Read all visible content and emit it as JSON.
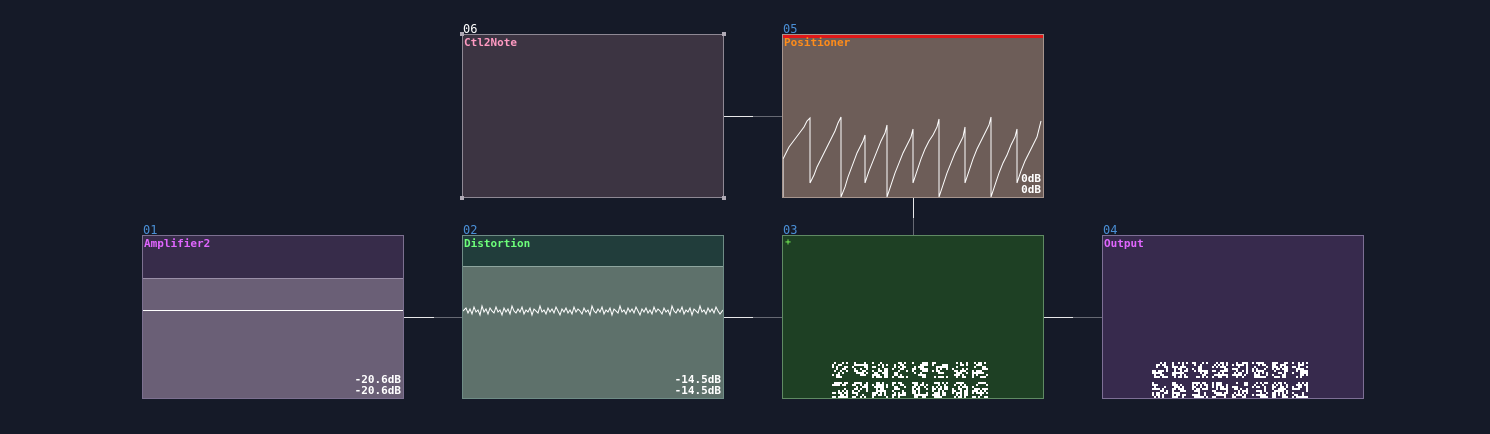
{
  "modules": [
    {
      "id": "06",
      "title": "Ctl2Note"
    },
    {
      "id": "05",
      "title": "Positioner",
      "levels": [
        "0dB",
        "0dB"
      ]
    },
    {
      "id": "01",
      "title": "Amplifier2",
      "levels": [
        "-20.6dB",
        "-20.6dB"
      ]
    },
    {
      "id": "02",
      "title": "Distortion",
      "levels": [
        "-14.5dB",
        "-14.5dB"
      ]
    },
    {
      "id": "03",
      "plus": "+"
    },
    {
      "id": "04",
      "title": "Output"
    }
  ],
  "colors": {
    "background": "#151a28",
    "module_number": "#4a8fd6",
    "ctl2note_title": "#ff9ac2",
    "positioner_title": "#ff8c1a",
    "amplifier_title": "#e066ff",
    "distortion_title": "#6dff7a",
    "output_title": "#e066ff",
    "wire": "#ffffff"
  }
}
